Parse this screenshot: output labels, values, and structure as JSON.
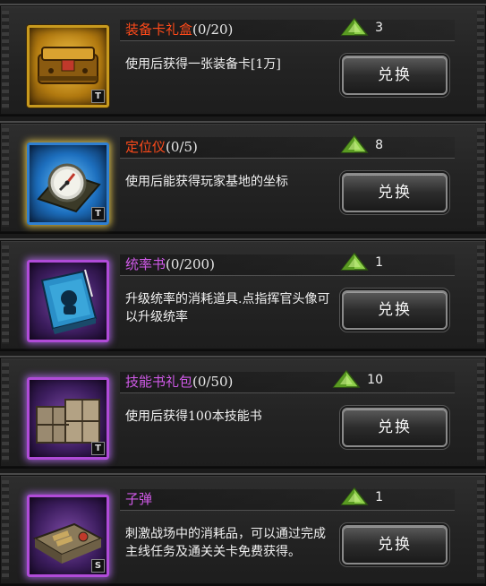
{
  "items": [
    {
      "name": "装备卡礼盒",
      "count": "(0/20)",
      "name_color": "orange",
      "price": "3",
      "description": "使用后获得一张装备卡[1万]",
      "button": "兑换",
      "tag": "T",
      "icon": "gold-chest-icon"
    },
    {
      "name": "定位仪",
      "count": "(0/5)",
      "name_color": "orange",
      "price": "8",
      "description": "使用后能获得玩家基地的坐标",
      "button": "兑换",
      "tag": "T",
      "icon": "compass-locator-icon"
    },
    {
      "name": "统率书",
      "count": "(0/200)",
      "name_color": "purple",
      "price": "1",
      "description": "升级统率的消耗道具.点指挥官头像可以升级统率",
      "button": "兑换",
      "tag": "",
      "icon": "leadership-book-icon"
    },
    {
      "name": "技能书礼包",
      "count": "(0/50)",
      "name_color": "purple",
      "price": "10",
      "description": "使用后获得100本技能书",
      "button": "兑换",
      "tag": "T",
      "icon": "crates-icon"
    },
    {
      "name": "子弹",
      "count": "",
      "name_color": "purple",
      "price": "1",
      "description": "刺激战场中的消耗品，可以通过完成主线任务及通关关卡免费获得。",
      "button": "兑换",
      "tag": "S",
      "icon": "ammo-box-icon"
    }
  ],
  "colors": {
    "orange_name": "#ff4a1a",
    "purple_name": "#d05ae8",
    "gem": "#7fc23a"
  }
}
